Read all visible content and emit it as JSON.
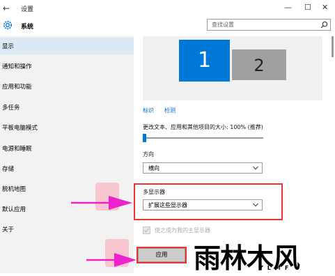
{
  "window": {
    "title": "设置",
    "back": "←",
    "minimize": "—",
    "maximize": "☐",
    "close": "✕"
  },
  "header": {
    "section": "系统",
    "search_placeholder": "查找设置"
  },
  "sidebar": {
    "items": [
      {
        "label": "显示"
      },
      {
        "label": "通知和操作"
      },
      {
        "label": "应用和功能"
      },
      {
        "label": "多任务"
      },
      {
        "label": "平板电脑模式"
      },
      {
        "label": "电源和睡眠"
      },
      {
        "label": "存储"
      },
      {
        "label": "脱机地图"
      },
      {
        "label": "默认应用"
      },
      {
        "label": "关于"
      }
    ],
    "selected_index": 0
  },
  "display": {
    "monitor1": "1",
    "monitor2": "2",
    "link_identify": "标识",
    "link_detect": "检测",
    "scale_label": "更改文本、应用和其他项目的大小: 100% (推荐)",
    "scale_value": 0,
    "orientation_label": "方向",
    "orientation_value": "横向",
    "multi_display_label": "多显示器",
    "multi_display_value": "扩展这些显示器",
    "main_display_checkbox": "使之成为我的主显示器",
    "apply_label": "应用"
  },
  "watermark": {
    "main": "雨林木风",
    "sub": "YLMF"
  },
  "colors": {
    "accent": "#0078d7",
    "highlight_box": "#e33333",
    "arrow": "#ee22cc"
  }
}
